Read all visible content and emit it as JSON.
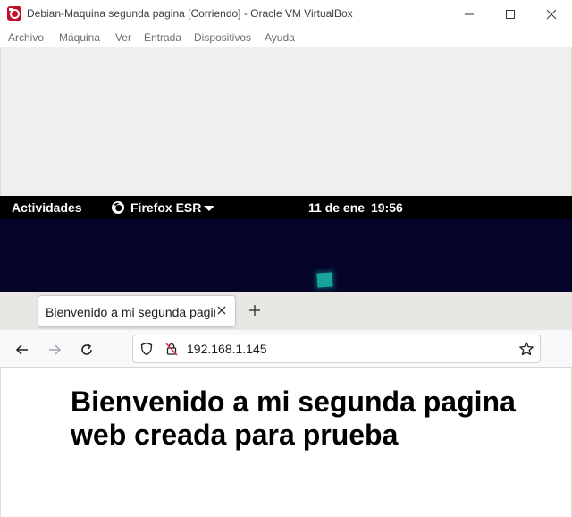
{
  "virtualbox": {
    "window_title": "Debian-Maquina segunda pagina [Corriendo] - Oracle VM VirtualBox",
    "menu": [
      "Archivo",
      "Máquina",
      "Ver",
      "Entrada",
      "Dispositivos",
      "Ayuda"
    ],
    "controls": [
      "minimize-icon",
      "maximize-icon",
      "close-icon"
    ]
  },
  "gnome": {
    "activities": "Actividades",
    "app_menu": "Firefox ESR",
    "date": "11 de ene",
    "time": "19:56"
  },
  "firefox": {
    "tab_title": "Bienvenido a mi segunda pagina web creada para prueba",
    "url": "192.168.1.145",
    "icons": [
      "back-icon",
      "forward-icon",
      "reload-icon",
      "shield-icon",
      "insecure-lock-icon",
      "bookmark-star-icon",
      "new-tab-icon",
      "tab-close-icon"
    ]
  },
  "page": {
    "heading": "Bienvenido a mi segunda pagina web creada para prueba"
  },
  "colors": {
    "gnome_bar": "#000000",
    "desktop": "#05052a",
    "heading_text": "#000000"
  }
}
